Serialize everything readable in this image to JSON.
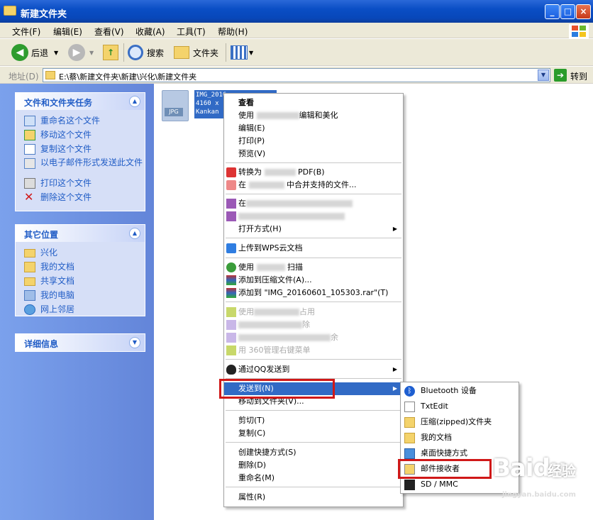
{
  "window": {
    "title": "新建文件夹",
    "min": "_",
    "max": "□",
    "close": "×"
  },
  "menu": [
    "文件(F)",
    "编辑(E)",
    "查看(V)",
    "收藏(A)",
    "工具(T)",
    "帮助(H)"
  ],
  "toolbar": {
    "back": "后退",
    "search": "搜索",
    "folders": "文件夹"
  },
  "address": {
    "label": "地址(D)",
    "path": "E:\\蔡\\新建文件夹\\新建\\兴化\\新建文件夹",
    "go": "转到"
  },
  "left": {
    "tasks": {
      "title": "文件和文件夹任务",
      "items": [
        "重命名这个文件",
        "移动这个文件",
        "复制这个文件",
        "以电子邮件形式发送此文件",
        "打印这个文件",
        "删除这个文件"
      ]
    },
    "places": {
      "title": "其它位置",
      "items": [
        "兴化",
        "我的文档",
        "共享文档",
        "我的电脑",
        "网上邻居"
      ]
    },
    "details": {
      "title": "详细信息"
    }
  },
  "file": {
    "badge": "JPG",
    "line1": "IMG_2016",
    "line2": "4160 x",
    "line3": "Kankan"
  },
  "context_menu": {
    "g1": [
      "查看",
      "使用",
      "编辑和美化",
      "编辑(E)",
      "打印(P)",
      "预览(V)"
    ],
    "g2": [
      "转换为",
      "PDF(B)",
      "在",
      "中合并支持的文件..."
    ],
    "g3": [
      "在",
      "打开方式(H)"
    ],
    "g4": [
      "上传到WPS云文档"
    ],
    "g5": [
      "使用",
      "扫描",
      "添加到压缩文件(A)...",
      "添加到 \"IMG_20160601_105303.rar\"(T)"
    ],
    "g6": [
      "使用",
      "占用",
      "除",
      "余",
      "用 360管理右键菜单"
    ],
    "g7": [
      "通过QQ发送到"
    ],
    "g8": [
      "发送到(N)",
      "移动到文件夹(V)..."
    ],
    "g9": [
      "剪切(T)",
      "复制(C)"
    ],
    "g10": [
      "创建快捷方式(S)",
      "删除(D)",
      "重命名(M)"
    ],
    "g11": [
      "属性(R)"
    ]
  },
  "sendto": [
    "Bluetooth 设备",
    "TxtEdit",
    "压缩(zipped)文件夹",
    "我的文档",
    "桌面快捷方式",
    "邮件接收者",
    "SD / MMC"
  ],
  "watermark": {
    "brand": "Baidu",
    "zh": "经验",
    "url": "jingyan.baidu.com"
  }
}
